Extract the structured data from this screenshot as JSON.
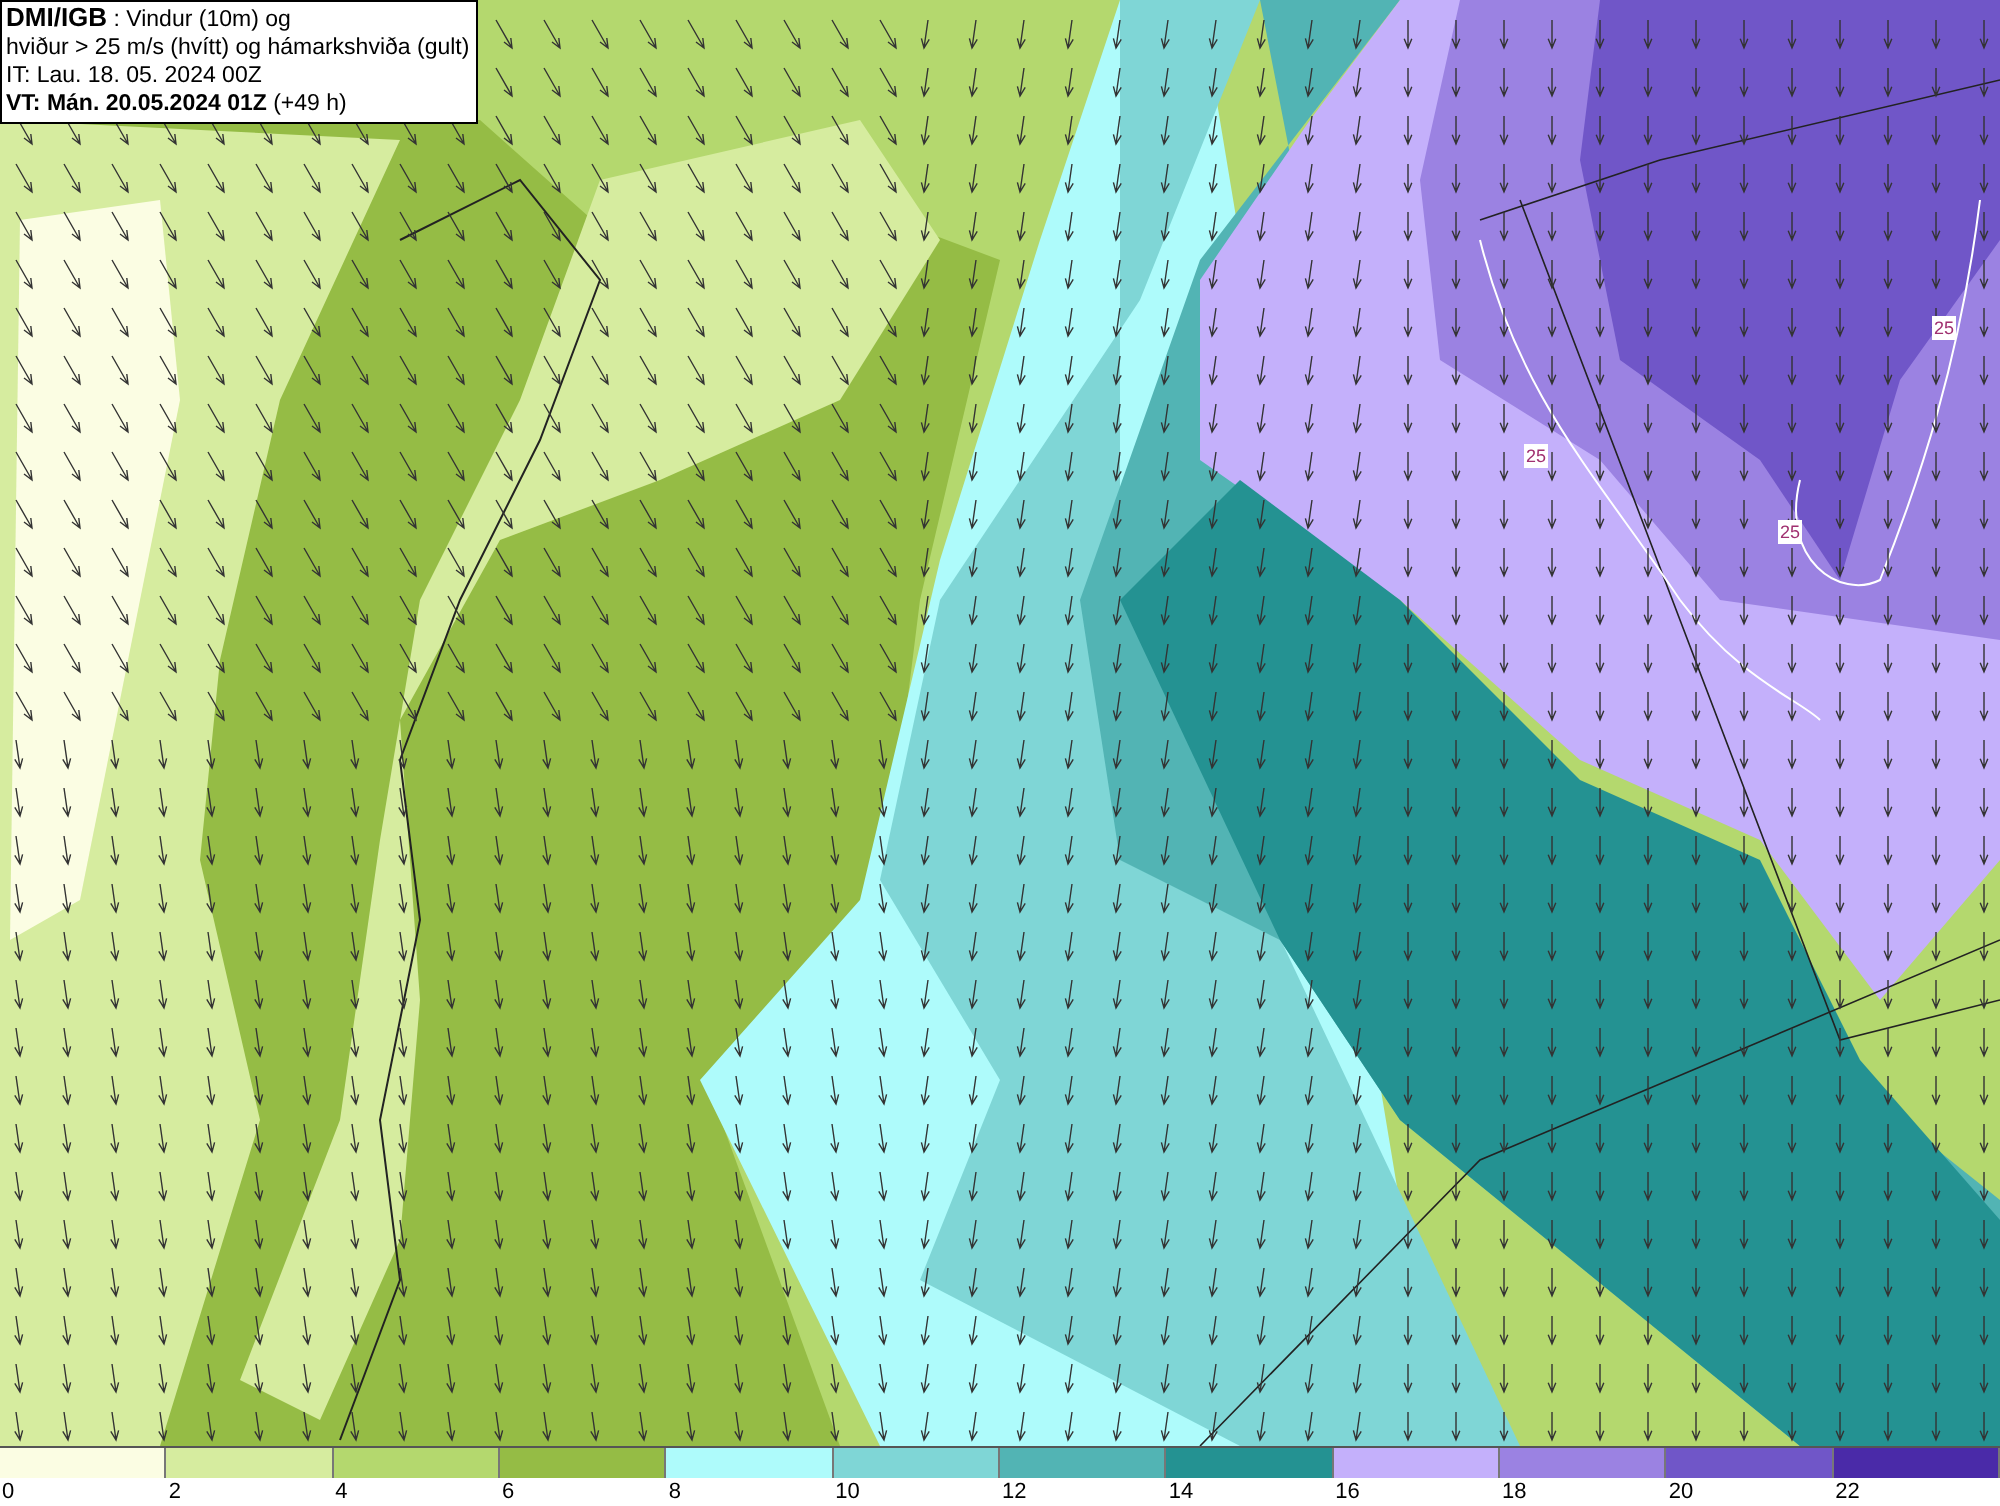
{
  "title_box": {
    "lines": [
      "**DMI/IGB** : Vindur (10m) og",
      "hviður > 25 m/s (hvítt) og hámarkshviða (gult)",
      "IT: Lau. 18. 05. 2024 00Z",
      "**VT: Mán. 20.05.2024 01Z** (+49 h)"
    ]
  },
  "contour_labels": [
    "25",
    "25",
    "25"
  ],
  "legend": {
    "bins": [
      {
        "color": "#fbfde3"
      },
      {
        "color": "#d6ec9f"
      },
      {
        "color": "#b4d86e"
      },
      {
        "color": "#95bc45"
      },
      {
        "color": "#aefbfb"
      },
      {
        "color": "#7fd6d6"
      },
      {
        "color": "#52b4b4"
      },
      {
        "color": "#249292"
      },
      {
        "color": "#c4b0fb"
      },
      {
        "color": "#9b82e2"
      },
      {
        "color": "#7056c8"
      },
      {
        "color": "#4a2aa8"
      }
    ],
    "ticks": [
      "0",
      "2",
      "4",
      "6",
      "8",
      "10",
      "12",
      "14",
      "16",
      "18",
      "20",
      "22"
    ]
  }
}
